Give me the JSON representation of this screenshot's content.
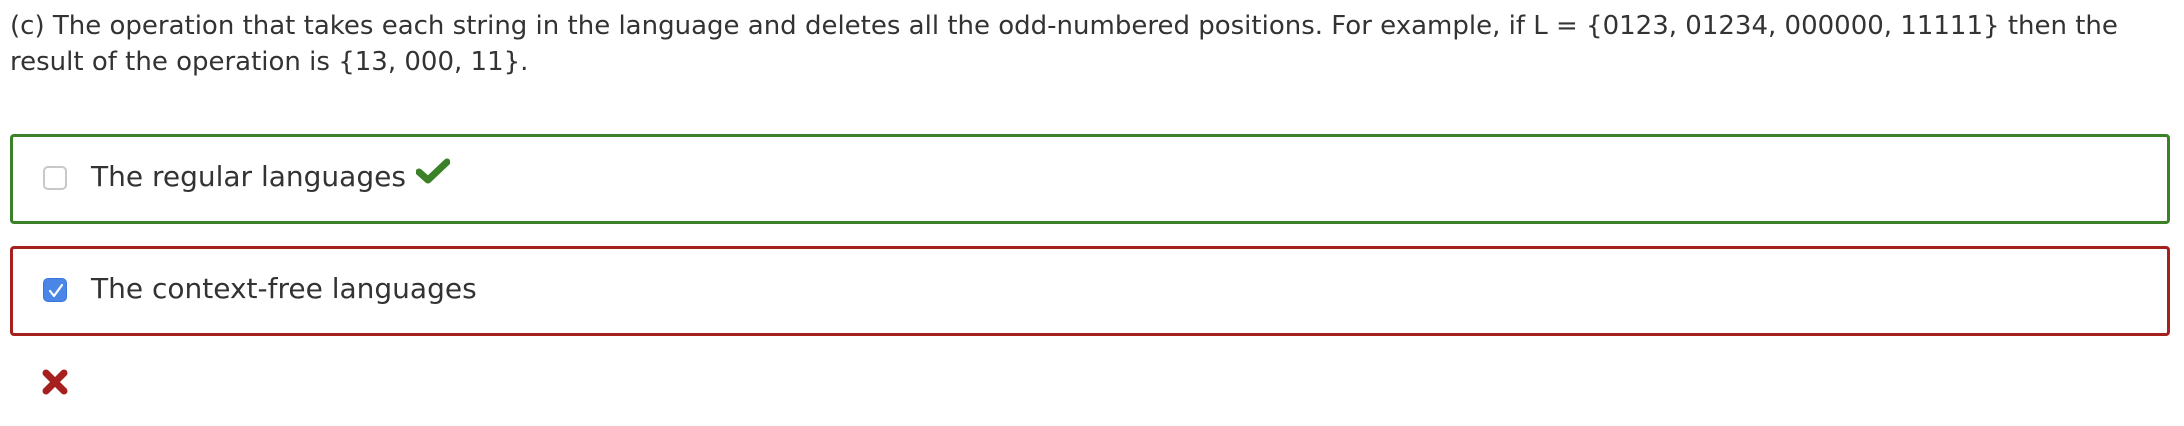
{
  "question": {
    "text": "(c) The operation that takes each string in the language and deletes all the odd-numbered positions. For example, if L = {0123, 01234, 000000, 11111} then the result of the operation is {13, 000, 11}."
  },
  "options": [
    {
      "label": "The regular languages",
      "checked": false,
      "status": "correct",
      "border_color": "#3b8128",
      "icon": "check-icon"
    },
    {
      "label": "The context-free languages",
      "checked": true,
      "status": "incorrect",
      "border_color": "#a6201f"
    }
  ],
  "result": {
    "icon": "x-icon",
    "color": "#a6201f"
  },
  "colors": {
    "correct": "#3b8128",
    "incorrect": "#a6201f",
    "checkbox_checked": "#4a86e8"
  }
}
